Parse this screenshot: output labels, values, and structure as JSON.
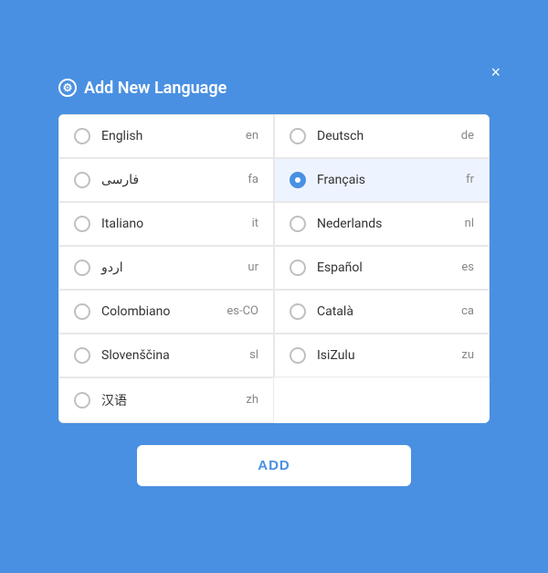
{
  "dialog": {
    "title": "Add New Language",
    "title_icon": "⚙",
    "close_icon": "×",
    "add_button_label": "ADD"
  },
  "languages": [
    {
      "id": "en",
      "name": "English",
      "code": "en",
      "selected": false,
      "col": 0
    },
    {
      "id": "de",
      "name": "Deutsch",
      "code": "de",
      "selected": false,
      "col": 1
    },
    {
      "id": "fa",
      "name": "فارسی",
      "code": "fa",
      "selected": false,
      "col": 0
    },
    {
      "id": "fr",
      "name": "Français",
      "code": "fr",
      "selected": true,
      "col": 1
    },
    {
      "id": "it",
      "name": "Italiano",
      "code": "it",
      "selected": false,
      "col": 0
    },
    {
      "id": "nl",
      "name": "Nederlands",
      "code": "nl",
      "selected": false,
      "col": 1
    },
    {
      "id": "ur",
      "name": "اردو",
      "code": "ur",
      "selected": false,
      "col": 0
    },
    {
      "id": "es",
      "name": "Español",
      "code": "es",
      "selected": false,
      "col": 1
    },
    {
      "id": "es-CO",
      "name": "Colombiano",
      "code": "es-CO",
      "selected": false,
      "col": 0
    },
    {
      "id": "ca",
      "name": "Català",
      "code": "ca",
      "selected": false,
      "col": 1
    },
    {
      "id": "sl",
      "name": "Slovenščina",
      "code": "sl",
      "selected": false,
      "col": 0
    },
    {
      "id": "zu",
      "name": "IsiZulu",
      "code": "zu",
      "selected": false,
      "col": 1
    },
    {
      "id": "zh",
      "name": "汉语",
      "code": "zh",
      "selected": false,
      "col": 0
    }
  ]
}
